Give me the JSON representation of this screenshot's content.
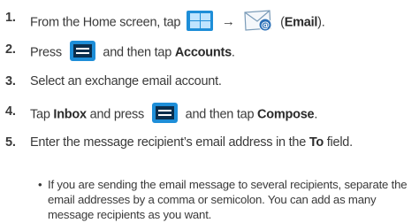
{
  "steps": [
    {
      "num": "1.",
      "text_a": "From the Home screen, tap",
      "arrow": "→",
      "paren_open": "(",
      "bold": "Email",
      "paren_close": ")."
    },
    {
      "num": "2.",
      "text_a": "Press",
      "text_b": "and then tap",
      "bold": "Accounts",
      "end": "."
    },
    {
      "num": "3.",
      "text": "Select an exchange email account."
    },
    {
      "num": "4.",
      "text_a": "Tap",
      "bold_a": "Inbox",
      "text_b": "and press",
      "text_c": "and then tap",
      "bold_b": "Compose",
      "end": "."
    },
    {
      "num": "5.",
      "text_a": "Enter the message recipient’s email address in the",
      "bold": "To",
      "end": "field."
    }
  ],
  "bullet": {
    "dot": "•",
    "text": "If you are sending the email message to several recipients, separate the email addresses by a comma or semicolon. You can add as many message recipients as you want."
  },
  "icons": {
    "home": "apps-grid-icon",
    "email": "email-icon",
    "menu": "menu-key-icon"
  },
  "colors": {
    "icon_blue": "#1e8ed8",
    "email_badge": "#2a6fb6"
  }
}
